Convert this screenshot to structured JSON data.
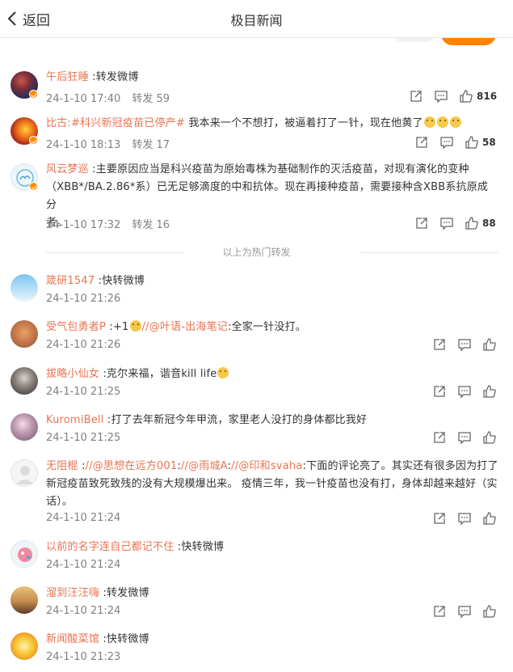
{
  "header": {
    "back_label": "返回",
    "title": "极目新闻"
  },
  "hot_reposts": [
    {
      "name": "午后狂睡",
      "content": " :转发微博",
      "time": "24-1-10 17:40",
      "forward": "转发 59",
      "likes": "816"
    },
    {
      "name": "比古",
      "link1": ":#科兴新冠疫苗已停产#",
      "content": " 我本来一个不想打，被逼着打了一针，现在他黄了",
      "time": "24-1-10 18:13",
      "forward": "转发 17",
      "likes": "58"
    },
    {
      "name": "风云梦巡",
      "content_line1": " :主要原因应当是科兴疫苗为原始毒株为基础制作的灭活疫苗，对现有演化的变种",
      "content_line2": "（XBB*/BA.2.86*系）已无足够滴度的中和抗体。现在再接种疫苗，需要接种含XBB系抗原成分",
      "content_line3": "者。",
      "time": "24-1-10 17:32",
      "forward": "转发 16",
      "likes": "88"
    }
  ],
  "hot_divider_label": "以上为热门转发",
  "reposts": [
    {
      "name": "箴研1547",
      "content": " :快转微博",
      "time": "24-1-10 21:26"
    },
    {
      "name": "受气包勇者P",
      "content_a": " :+1",
      "link1": "//@叶语-出海笔记",
      "content_b": ":全家一针没打。",
      "time": "24-1-10 21:26"
    },
    {
      "name": "拔略小仙女",
      "content": " :克尔来福，谐音kill  life",
      "time": "24-1-10 21:25"
    },
    {
      "name": "KuromiBell",
      "content": " :打了去年新冠今年甲流，家里老人没打的身体都比我好",
      "time": "24-1-10 21:25"
    },
    {
      "name": "无阻棍",
      "sep1": " :",
      "link1": "//@思想在远方001",
      "sep2": ":",
      "link2": "//@雨城A",
      "sep3": ":",
      "link3": "//@印和svaha",
      "content_line1": ":下面的评论亮了。其实还有很多因为打了",
      "content_line2": "新冠疫苗致死致残的没有大规模爆出来。 疫情三年，我一针疫苗也没有打，身体却越来越好（实",
      "content_line3": "话）。",
      "time": "24-1-10 21:24"
    },
    {
      "name": "以前的名字连自己都记不住",
      "content": " :快转微博",
      "time": "24-1-10 21:24"
    },
    {
      "name": "溜到汪汪嗨",
      "content": " :转发微博",
      "time": "24-1-10 21:24"
    },
    {
      "name": "新闻酸菜馆",
      "content": " :快转微博",
      "time": "24-1-10 21:23"
    }
  ],
  "colors": {
    "accent": "#eb7350",
    "orange": "#ff8200",
    "meta": "#808080"
  }
}
